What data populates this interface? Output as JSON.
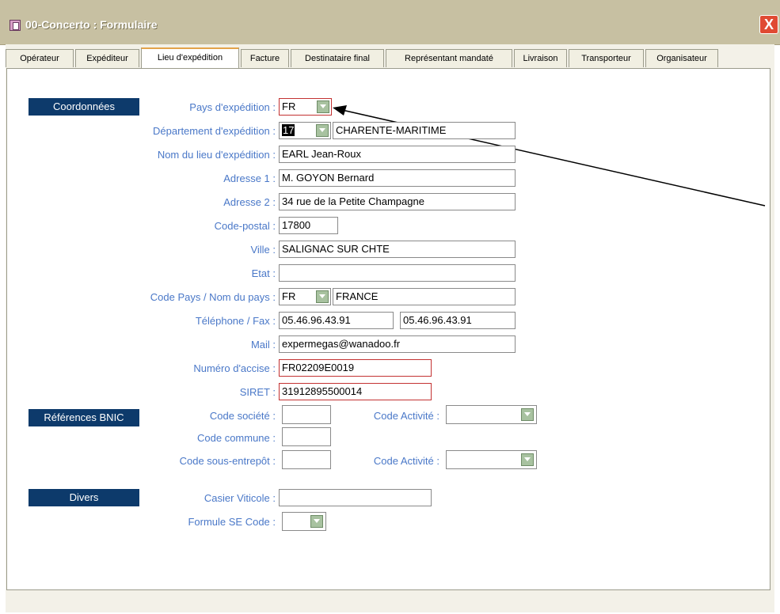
{
  "window": {
    "title": "00-Concerto : Formulaire",
    "close_label": "X"
  },
  "tabs": [
    {
      "label": "Opérateur"
    },
    {
      "label": "Expéditeur"
    },
    {
      "label": "Lieu d'expédition",
      "active": true
    },
    {
      "label": "Facture"
    },
    {
      "label": "Destinataire final"
    },
    {
      "label": "Représentant mandaté"
    },
    {
      "label": "Livraison"
    },
    {
      "label": "Transporteur"
    },
    {
      "label": "Organisateur"
    }
  ],
  "sections": {
    "coordonnees": "Coordonnées",
    "references": "Références BNIC",
    "divers": "Divers"
  },
  "form": {
    "pays_exp": {
      "label": "Pays d'expédition :",
      "value": "FR"
    },
    "dept": {
      "label": "Département d'expédition :",
      "code": "17",
      "name": "CHARENTE-MARITIME"
    },
    "nom_lieu": {
      "label": "Nom du lieu d'expédition :",
      "value": "EARL Jean-Roux"
    },
    "adresse1": {
      "label": "Adresse 1 :",
      "value": "M. GOYON Bernard"
    },
    "adresse2": {
      "label": "Adresse 2 :",
      "value": "34 rue de la Petite Champagne"
    },
    "code_postal": {
      "label": "Code-postal :",
      "value": "17800"
    },
    "ville": {
      "label": "Ville :",
      "value": "SALIGNAC SUR CHTE"
    },
    "etat": {
      "label": "Etat :",
      "value": ""
    },
    "code_pays": {
      "label": "Code Pays / Nom du pays :",
      "code": "FR",
      "name": "FRANCE"
    },
    "tel_fax": {
      "label": "Téléphone / Fax :",
      "tel": "05.46.96.43.91",
      "fax": "05.46.96.43.91"
    },
    "mail": {
      "label": "Mail :",
      "value": "expermegas@wanadoo.fr"
    },
    "accise": {
      "label": "Numéro d'accise :",
      "value": "FR02209E0019"
    },
    "siret": {
      "label": "SIRET :",
      "value": "31912895500014"
    }
  },
  "bnic": {
    "code_societe": {
      "label": "Code société :",
      "value": ""
    },
    "code_activite1": {
      "label": "Code Activité :",
      "value": ""
    },
    "code_commune": {
      "label": "Code commune :",
      "value": ""
    },
    "code_sous_entrepot": {
      "label": "Code sous-entrepôt :",
      "value": ""
    },
    "code_activite2": {
      "label": "Code Activité :",
      "value": ""
    }
  },
  "divers": {
    "casier": {
      "label": "Casier Viticole :",
      "value": ""
    },
    "formule": {
      "label": "Formule SE Code :",
      "value": ""
    }
  },
  "colors": {
    "section_bg": "#0d3a6b",
    "label": "#4a78c8",
    "required_border": "#c33232",
    "titlebar": "#c7c0a2"
  }
}
